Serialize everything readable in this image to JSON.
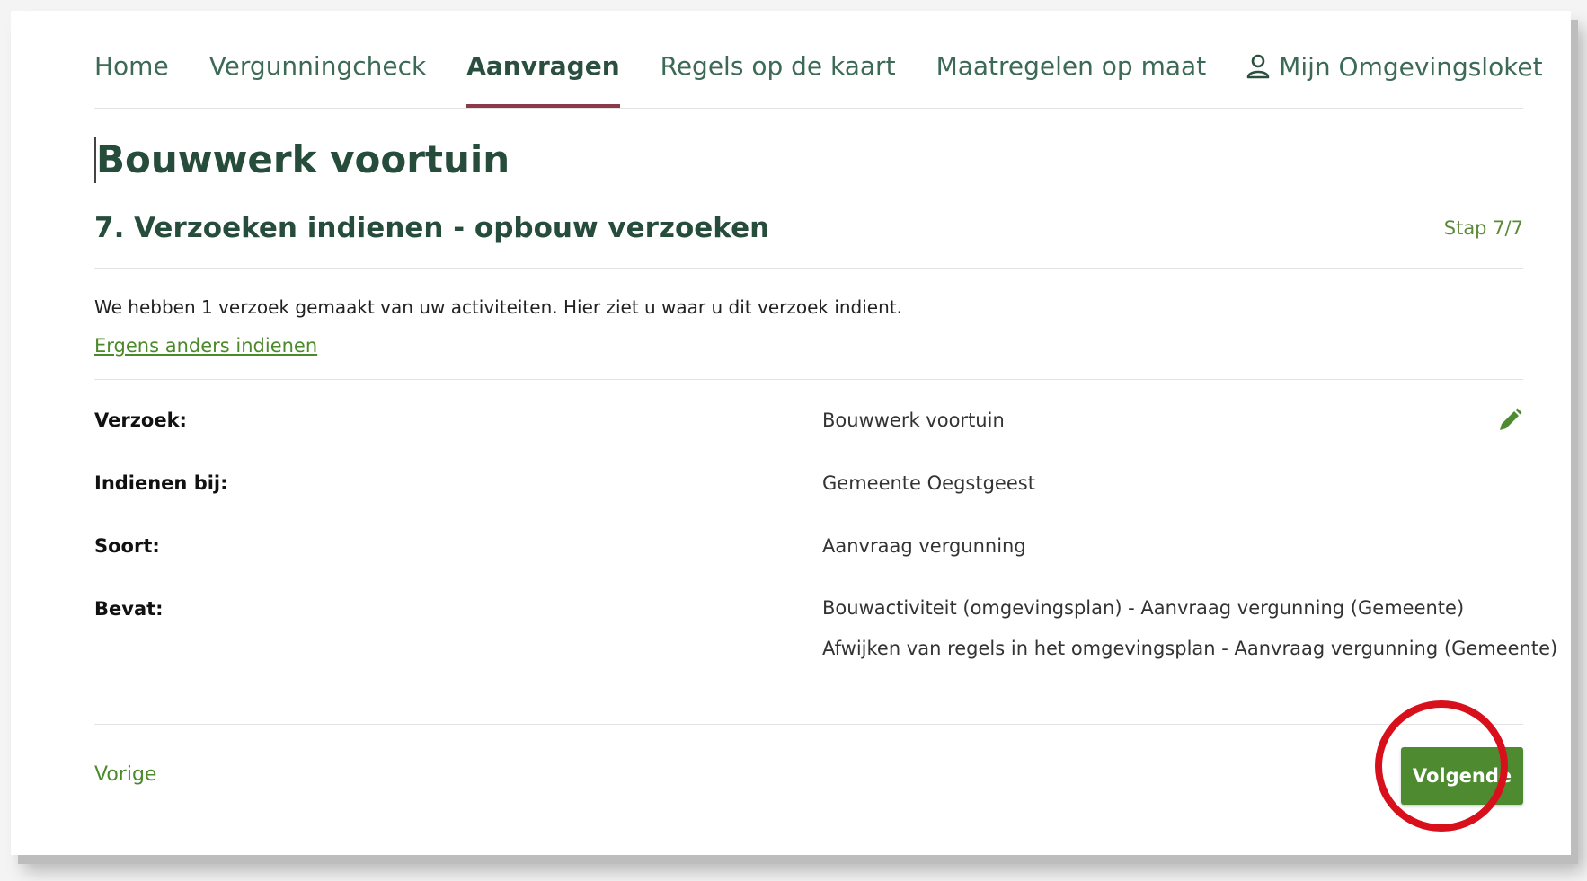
{
  "nav": {
    "items": [
      {
        "label": "Home"
      },
      {
        "label": "Vergunningcheck"
      },
      {
        "label": "Aanvragen",
        "active": true
      },
      {
        "label": "Regels op de kaart"
      },
      {
        "label": "Maatregelen op maat"
      }
    ],
    "account_label": "Mijn Omgevingsloket"
  },
  "page": {
    "title": "Bouwwerk voortuin",
    "step_title": "7. Verzoeken indienen - opbouw verzoeken",
    "step_counter": "Stap 7/7",
    "intro": "We hebben 1 verzoek gemaakt van uw activiteiten. Hier ziet u waar u dit verzoek indient.",
    "alt_link": "Ergens anders indienen"
  },
  "summary": {
    "rows": [
      {
        "label": "Verzoek:",
        "value": "Bouwwerk voortuin"
      },
      {
        "label": "Indienen bij:",
        "value": "Gemeente Oegstgeest"
      },
      {
        "label": "Soort:",
        "value": "Aanvraag vergunning"
      },
      {
        "label": "Bevat:",
        "values": [
          "Bouwactiviteit (omgevingsplan) - Aanvraag vergunning (Gemeente)",
          "Afwijken van regels in het omgevingsplan - Aanvraag vergunning (Gemeente)"
        ]
      }
    ]
  },
  "footer": {
    "back_label": "Vorige",
    "next_label": "Volgende"
  },
  "colors": {
    "brand_green": "#4e8a2f",
    "nav_text": "#3d6a57",
    "active_underline": "#8a3a4a",
    "highlight": "#d8101c"
  },
  "icons": {
    "account": "user-icon",
    "edit": "pencil-icon"
  }
}
